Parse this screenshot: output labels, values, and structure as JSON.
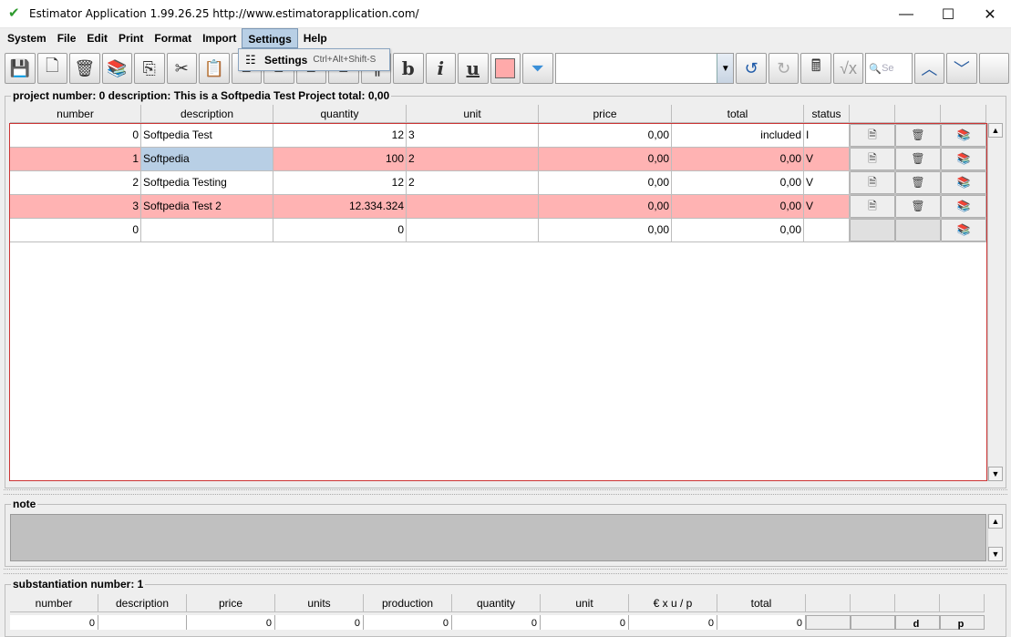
{
  "window": {
    "title": "Estimator Application 1.99.26.25 http://www.estimatorapplication.com/",
    "minimize": "—",
    "maximize": "☐",
    "close": "✕"
  },
  "menubar": {
    "items": [
      "System",
      "File",
      "Edit",
      "Print",
      "Format",
      "Import",
      "Settings",
      "Help"
    ],
    "active": "Settings"
  },
  "dropdown": {
    "label": "Settings",
    "shortcut": "Ctrl+Alt+Shift-S"
  },
  "toolbar": {
    "bold": "b",
    "italic": "i",
    "underline": "u",
    "combo_value": "",
    "search_placeholder": "Se",
    "swatch_color": "#ffaaaa"
  },
  "project": {
    "title": "project number: 0 description: This is a Softpedia Test Project total: 0,00",
    "columns": [
      "number",
      "description",
      "quantity",
      "unit",
      "price",
      "total",
      "status"
    ],
    "rows": [
      {
        "number": "0",
        "description": "Softpedia Test",
        "quantity": "12",
        "unit": "3",
        "price": "0,00",
        "total": "included",
        "status": "I",
        "pink": false
      },
      {
        "number": "1",
        "description": "Softpedia",
        "quantity": "100",
        "unit": "2",
        "price": "0,00",
        "total": "0,00",
        "status": "V",
        "pink": true
      },
      {
        "number": "2",
        "description": "Softpedia Testing",
        "quantity": "12",
        "unit": "2",
        "price": "0,00",
        "total": "0,00",
        "status": "V",
        "pink": false
      },
      {
        "number": "3",
        "description": "Softpedia Test 2",
        "quantity": "12.334.324",
        "unit": "",
        "price": "0,00",
        "total": "0,00",
        "status": "V",
        "pink": true
      },
      {
        "number": "0",
        "description": "",
        "quantity": "0",
        "unit": "",
        "price": "0,00",
        "total": "0,00",
        "status": "",
        "pink": false
      }
    ]
  },
  "note": {
    "title": "note"
  },
  "substantiation": {
    "title": "substantiation number: 1",
    "columns": [
      "number",
      "description",
      "price",
      "units",
      "production",
      "quantity",
      "unit",
      "€ x u / p",
      "total"
    ],
    "row": [
      "0",
      "",
      "0",
      "0",
      "0",
      "0",
      "0",
      "0",
      "0"
    ],
    "btn_d": "d",
    "btn_p": "p"
  }
}
